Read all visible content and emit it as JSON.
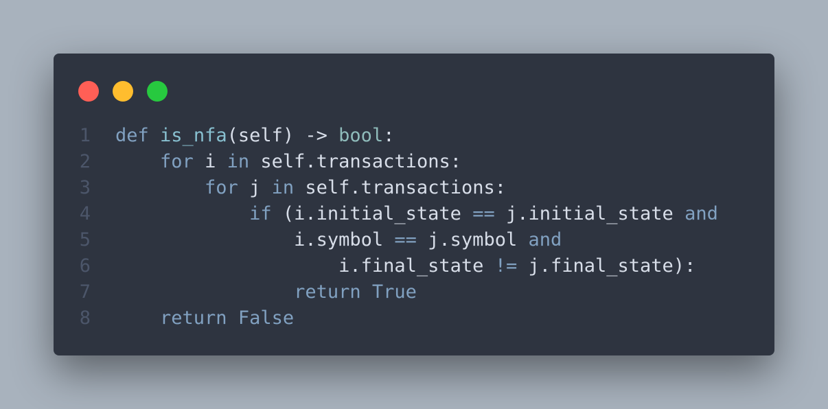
{
  "window": {
    "buttons": {
      "close_color": "#ff5f56",
      "minimize_color": "#ffbd2e",
      "maximize_color": "#27c93f"
    },
    "background_color": "#2e3440"
  },
  "code": {
    "lines": [
      {
        "number": "1",
        "tokens": [
          {
            "t": "def",
            "c": "kw"
          },
          {
            "t": " ",
            "c": "tx"
          },
          {
            "t": "is_nfa",
            "c": "fn"
          },
          {
            "t": "(self) ",
            "c": "tx"
          },
          {
            "t": "->",
            "c": "tx"
          },
          {
            "t": " ",
            "c": "tx"
          },
          {
            "t": "bool",
            "c": "ty"
          },
          {
            "t": ":",
            "c": "tx"
          }
        ]
      },
      {
        "number": "2",
        "tokens": [
          {
            "t": "    ",
            "c": "tx"
          },
          {
            "t": "for",
            "c": "kw"
          },
          {
            "t": " i ",
            "c": "tx"
          },
          {
            "t": "in",
            "c": "kw"
          },
          {
            "t": " self.transactions:",
            "c": "tx"
          }
        ]
      },
      {
        "number": "3",
        "tokens": [
          {
            "t": "        ",
            "c": "tx"
          },
          {
            "t": "for",
            "c": "kw"
          },
          {
            "t": " j ",
            "c": "tx"
          },
          {
            "t": "in",
            "c": "kw"
          },
          {
            "t": " self.transactions:",
            "c": "tx"
          }
        ]
      },
      {
        "number": "4",
        "tokens": [
          {
            "t": "            ",
            "c": "tx"
          },
          {
            "t": "if",
            "c": "kw"
          },
          {
            "t": " (i.initial_state ",
            "c": "tx"
          },
          {
            "t": "==",
            "c": "op"
          },
          {
            "t": " j.initial_state ",
            "c": "tx"
          },
          {
            "t": "and",
            "c": "kw"
          }
        ]
      },
      {
        "number": "5",
        "tokens": [
          {
            "t": "                i.symbol ",
            "c": "tx"
          },
          {
            "t": "==",
            "c": "op"
          },
          {
            "t": " j.symbol ",
            "c": "tx"
          },
          {
            "t": "and",
            "c": "kw"
          }
        ]
      },
      {
        "number": "6",
        "tokens": [
          {
            "t": "                    i.final_state ",
            "c": "tx"
          },
          {
            "t": "!=",
            "c": "op"
          },
          {
            "t": " j.final_state):",
            "c": "tx"
          }
        ]
      },
      {
        "number": "7",
        "tokens": [
          {
            "t": "                ",
            "c": "tx"
          },
          {
            "t": "return",
            "c": "kw"
          },
          {
            "t": " ",
            "c": "tx"
          },
          {
            "t": "True",
            "c": "kw"
          }
        ]
      },
      {
        "number": "8",
        "tokens": [
          {
            "t": "    ",
            "c": "tx"
          },
          {
            "t": "return",
            "c": "kw"
          },
          {
            "t": " ",
            "c": "tx"
          },
          {
            "t": "False",
            "c": "kw"
          }
        ]
      }
    ]
  }
}
